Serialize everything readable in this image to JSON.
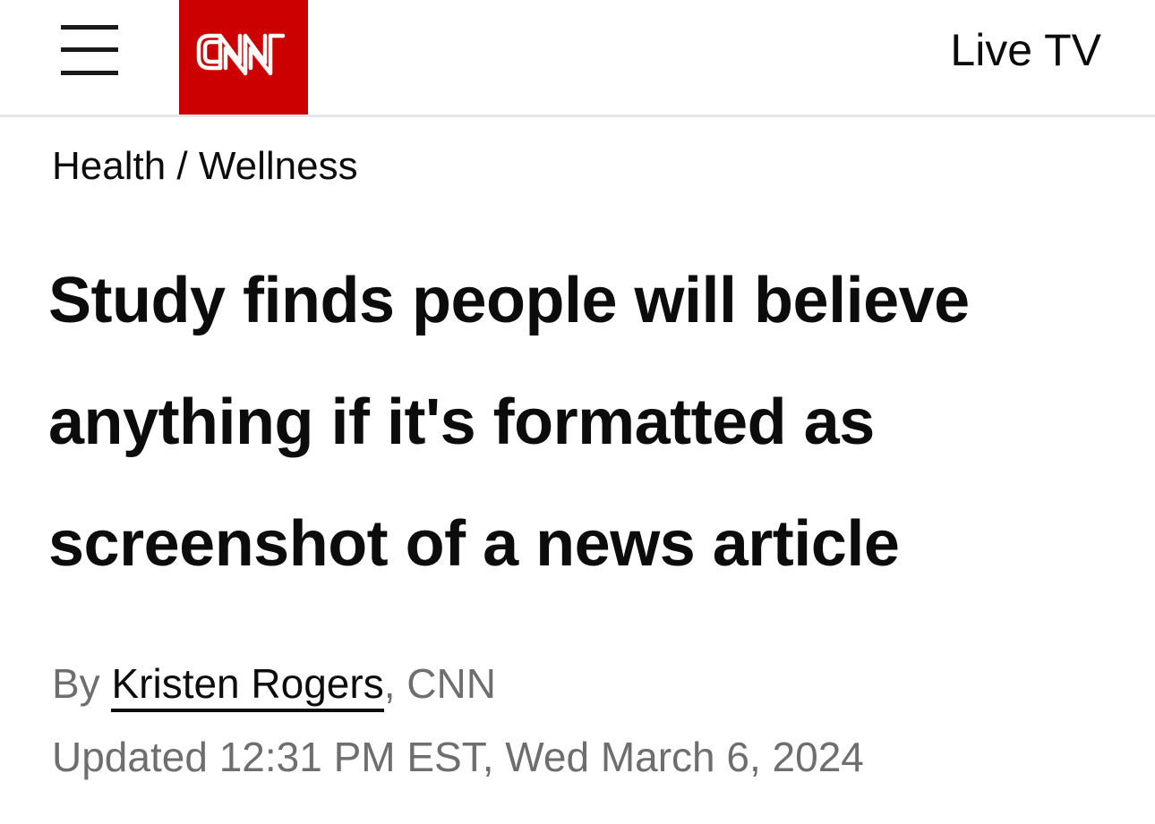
{
  "header": {
    "menu_icon": "hamburger-menu-icon",
    "logo_text": "CNN",
    "logo_color": "#cc0000",
    "live_tv_label": "Live TV"
  },
  "breadcrumb": {
    "section": "Health",
    "separator": "/",
    "subsection": "Wellness"
  },
  "article": {
    "headline_lines": [
      "Study finds people will believe",
      "anything if it's formatted as",
      "screenshot of a news article"
    ],
    "byline_prefix": "By",
    "author": "Kristen Rogers",
    "byline_suffix": ", CNN",
    "updated": "Updated 12:31 PM EST, Wed March 6, 2024"
  }
}
